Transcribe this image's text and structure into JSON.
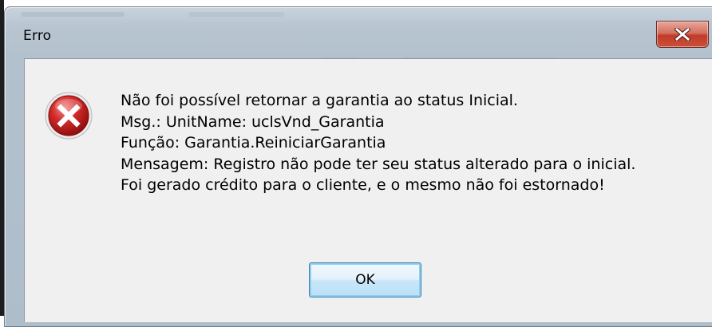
{
  "dialog": {
    "title": "Erro",
    "close_icon": "close-x-icon",
    "message_icon": "error-icon",
    "message_lines": [
      "Não foi possível retornar a garantia ao status Inicial.",
      "Msg.: UnitName: uclsVnd_Garantia",
      "Função: Garantia.ReiniciarGarantia",
      "Mensagem: Registro não pode ter seu status alterado para o inicial.",
      "Foi gerado crédito para o cliente, e o mesmo não foi estornado!"
    ],
    "ok_label": "OK"
  },
  "colors": {
    "close_button": "#c7412e",
    "error_icon": "#c8171c",
    "content_background": "#f0f0f0",
    "ok_button_border": "#3c7fb1"
  }
}
